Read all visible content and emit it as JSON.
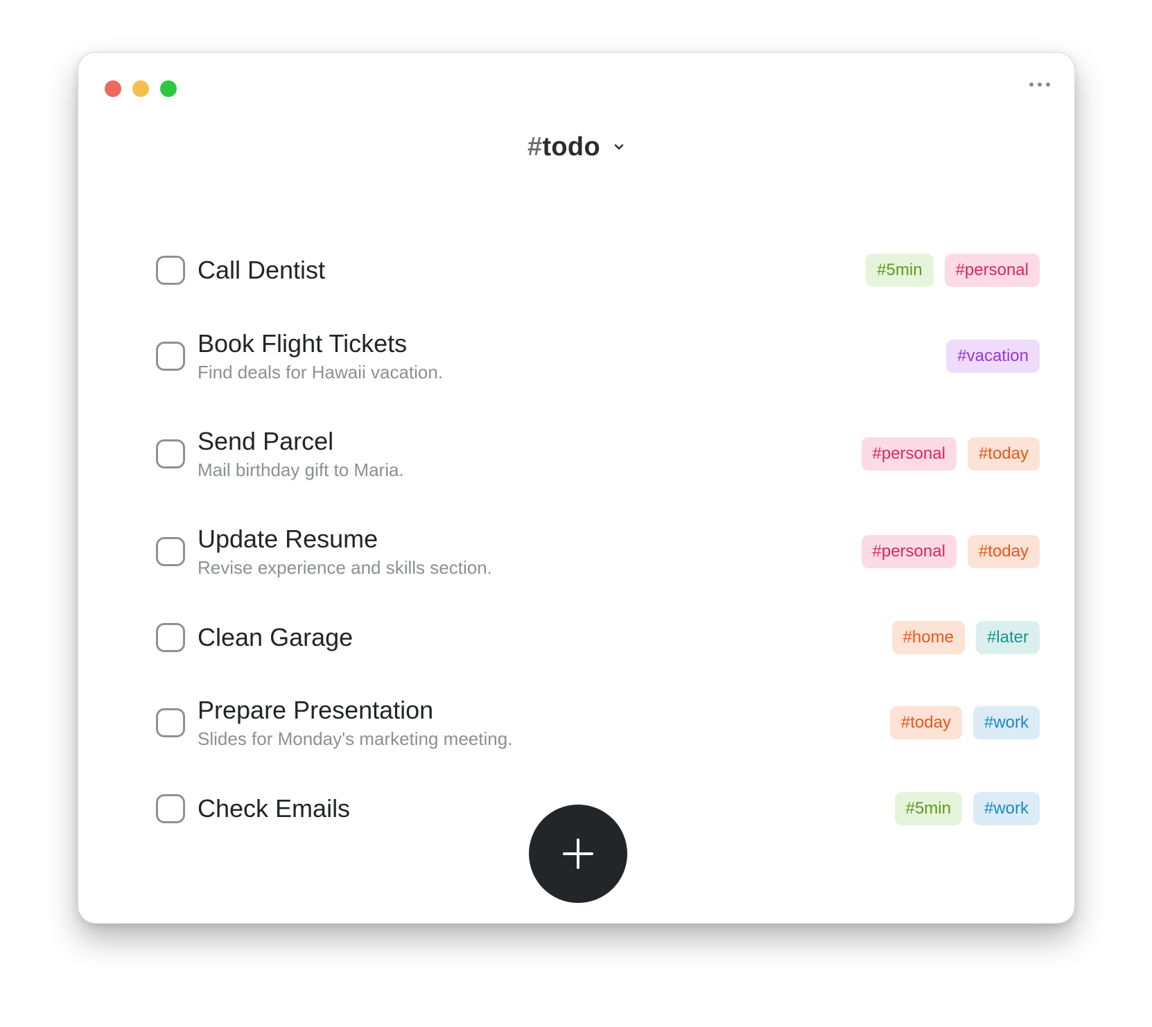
{
  "window": {
    "controls": [
      {
        "name": "close-button",
        "color": "#ed6a5e"
      },
      {
        "name": "minimize-button",
        "color": "#f5bf4f"
      },
      {
        "name": "zoom-button",
        "color": "#2bc840"
      }
    ],
    "more_icon": "ellipsis-icon"
  },
  "header": {
    "hash": "#",
    "title": "todo",
    "chevron_icon": "chevron-down-icon"
  },
  "tag_styles": {
    "#5min": {
      "bg": "#e6f4dc",
      "fg": "#5f9a1f"
    },
    "#personal": {
      "bg": "#fcdbe6",
      "fg": "#e0245e"
    },
    "#vacation": {
      "bg": "#efdcfb",
      "fg": "#9b33d9"
    },
    "#today": {
      "bg": "#fde2d6",
      "fg": "#e8571a"
    },
    "#home": {
      "bg": "#fde2d6",
      "fg": "#e8571a"
    },
    "#later": {
      "bg": "#dcefef",
      "fg": "#17948f"
    },
    "#work": {
      "bg": "#dbecf7",
      "fg": "#1d88c9"
    }
  },
  "tasks": [
    {
      "title": "Call Dentist",
      "description": "",
      "checked": false,
      "tags": [
        "#5min",
        "#personal"
      ]
    },
    {
      "title": "Book Flight Tickets",
      "description": "Find deals for Hawaii vacation.",
      "checked": false,
      "tags": [
        "#vacation"
      ]
    },
    {
      "title": "Send Parcel",
      "description": "Mail birthday gift to Maria.",
      "checked": false,
      "tags": [
        "#personal",
        "#today"
      ]
    },
    {
      "title": "Update Resume",
      "description": "Revise experience and skills section.",
      "checked": false,
      "tags": [
        "#personal",
        "#today"
      ]
    },
    {
      "title": "Clean Garage",
      "description": "",
      "checked": false,
      "tags": [
        "#home",
        "#later"
      ]
    },
    {
      "title": "Prepare Presentation",
      "description": "Slides for Monday's marketing meeting.",
      "checked": false,
      "tags": [
        "#today",
        "#work"
      ]
    },
    {
      "title": "Check Emails",
      "description": "",
      "checked": false,
      "tags": [
        "#5min",
        "#work"
      ]
    }
  ],
  "fab": {
    "icon": "plus-icon"
  }
}
